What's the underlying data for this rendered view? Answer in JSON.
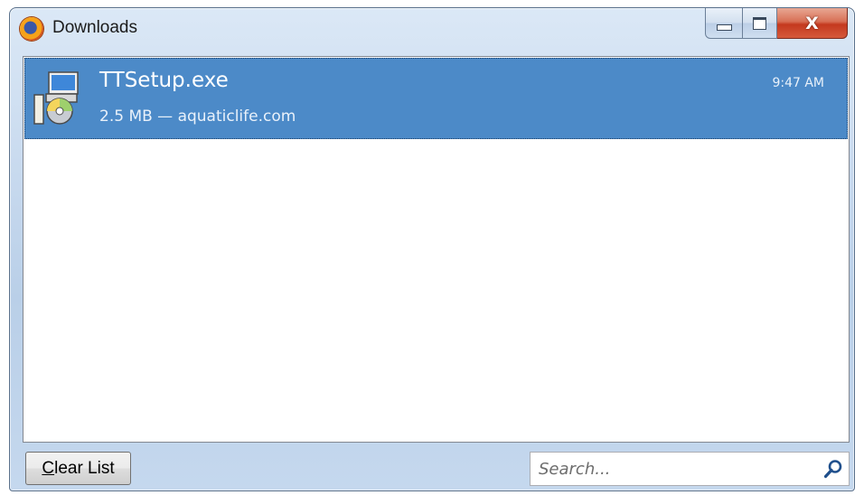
{
  "window": {
    "title": "Downloads",
    "app_icon": "firefox-icon",
    "controls": {
      "minimize": "minimize-icon",
      "maximize": "maximize-icon",
      "close_glyph": "X"
    }
  },
  "downloads": [
    {
      "name": "TTSetup.exe",
      "meta": "2.5 MB — aquaticlife.com",
      "time": "9:47 AM",
      "icon": "installer-icon",
      "selected": true
    }
  ],
  "footer": {
    "clear_accesskey": "C",
    "clear_rest": "lear List",
    "search_placeholder": "Search...",
    "search_icon": "magnifier-icon"
  },
  "colors": {
    "selection": "#4c8ac8",
    "close_button": "#c4391e",
    "frame": "#c7d9ee"
  }
}
